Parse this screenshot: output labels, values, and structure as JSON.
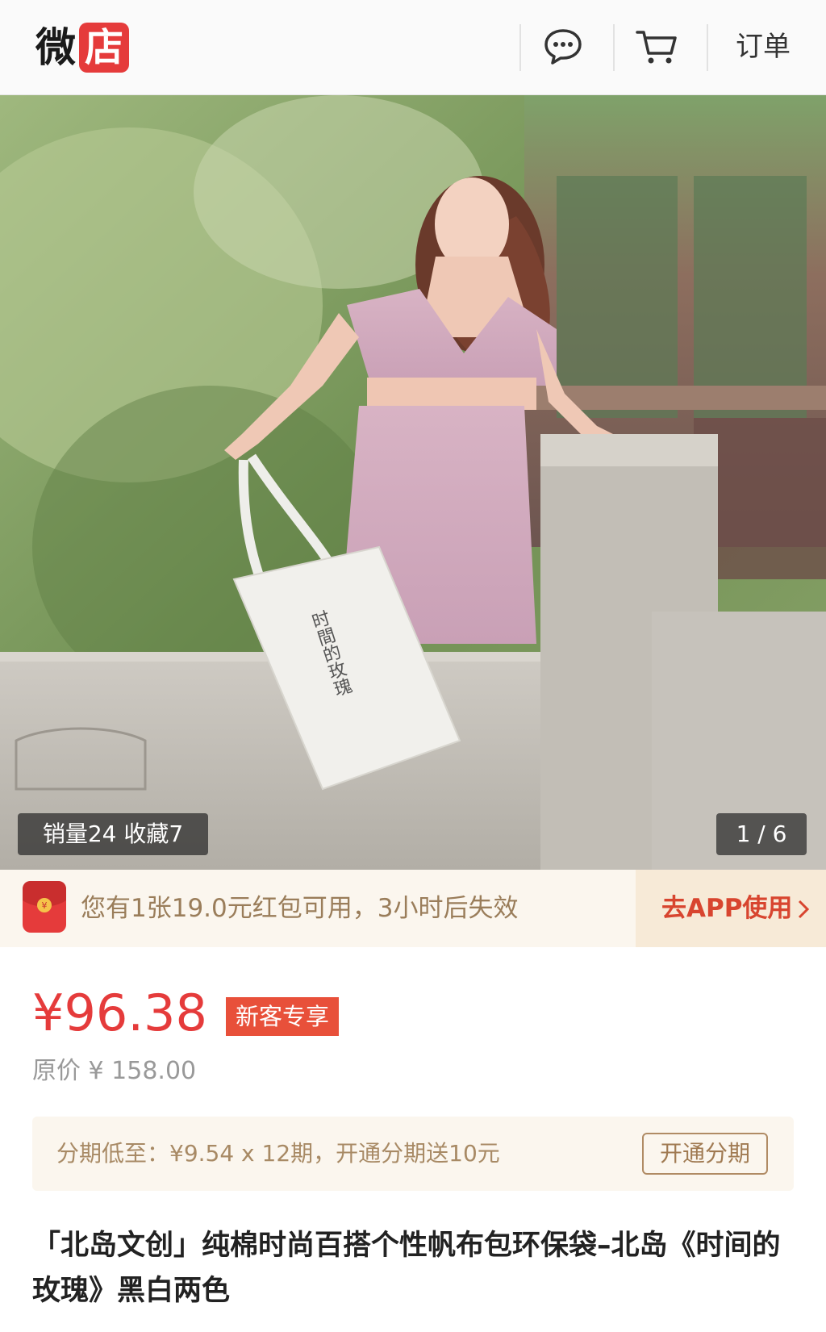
{
  "header": {
    "logo_left": "微",
    "logo_right": "店",
    "orders_label": "订单",
    "icons": [
      "chat-icon",
      "cart-icon"
    ]
  },
  "hero": {
    "bag_text": "时間的玫瑰",
    "stats": "销量24 收藏7",
    "page_indicator": "1 / 6"
  },
  "red_packet": {
    "message": "您有1张19.0元红包可用，3小时后失效",
    "cta_label": "去APP使用",
    "icon": "red-envelope-icon"
  },
  "price": {
    "current": "¥96.38",
    "tag": "新客专享",
    "original": "原价 ¥ 158.00"
  },
  "installment": {
    "text": "分期低至：¥9.54 x 12期，开通分期送10元",
    "button_label": "开通分期"
  },
  "product": {
    "title": "「北岛文创」纯棉时尚百搭个性帆布包环保袋–北岛《时间的玫瑰》黑白两色"
  },
  "colors": {
    "accent_red": "#e53b3b",
    "gold_text": "#a88a65",
    "cream_bg": "#fbf6ee"
  }
}
